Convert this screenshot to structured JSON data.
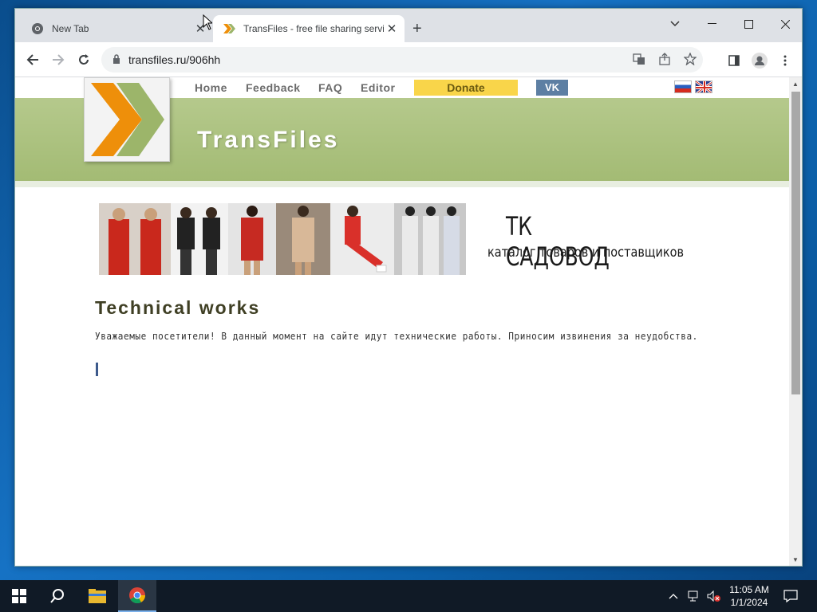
{
  "browser": {
    "tabs": [
      {
        "title": "New Tab",
        "active": false
      },
      {
        "title": "TransFiles - free file sharing servi",
        "active": true
      }
    ],
    "address": "transfiles.ru/906hh",
    "new_tab_symbol": "+"
  },
  "site": {
    "nav": {
      "home": "Home",
      "feedback": "Feedback",
      "faq": "FAQ",
      "editor": "Editor",
      "donate": "Donate",
      "vk": "VK"
    },
    "banner_title": "TransFiles",
    "ad": {
      "title": "ТК САДОВОД",
      "subtitle": "каталог товаров и поставщиков"
    },
    "heading": "Technical works",
    "message": "Уважаемые посетители! В данный момент на сайте идут технические работы. Приносим извинения за неудобства."
  },
  "taskbar": {
    "time": "11:05 AM",
    "date": "1/1/2024"
  },
  "colors": {
    "banner_green": "#a9bf7d",
    "donate_yellow": "#f9d54a",
    "vk_blue": "#5d7fa3",
    "logo_orange": "#ee8f0a",
    "logo_green": "#9cb56a"
  }
}
